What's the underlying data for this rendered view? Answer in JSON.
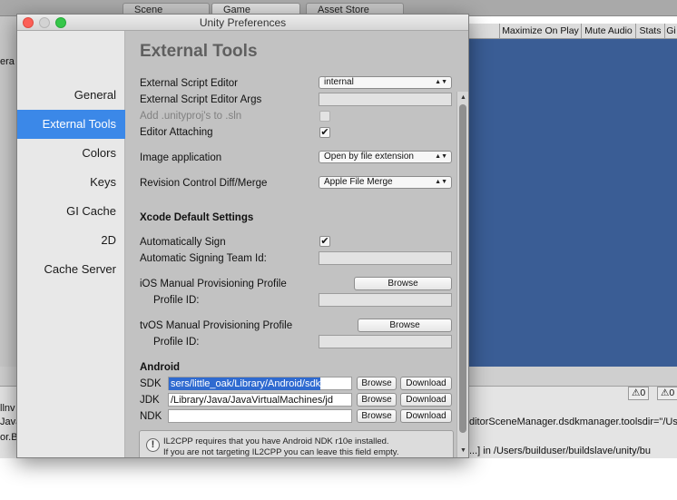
{
  "background": {
    "tabs": [
      "Scene",
      "Game",
      "Asset Store"
    ],
    "game_toolbar": [
      "Maximize On Play",
      "Mute Audio",
      "Stats",
      "Gi"
    ],
    "left_text": "era",
    "console_lines": [
      "llnv",
      "Java",
      "or.B",
      "ditorSceneManager.dsdkmanager.toolsdir=\"/Users/little_oak/Lib",
      "...] in /Users/builduser/buildslave/unity/bu"
    ],
    "console_counts": [
      "0",
      "0"
    ],
    "colors": {
      "game_view": "#3a5d95"
    }
  },
  "window": {
    "title": "Unity Preferences",
    "sidebar": {
      "items": [
        {
          "label": "General",
          "selected": false
        },
        {
          "label": "External Tools",
          "selected": true
        },
        {
          "label": "Colors",
          "selected": false
        },
        {
          "label": "Keys",
          "selected": false
        },
        {
          "label": "GI Cache",
          "selected": false
        },
        {
          "label": "2D",
          "selected": false
        },
        {
          "label": "Cache Server",
          "selected": false
        }
      ]
    },
    "content": {
      "heading": "External Tools",
      "external_script_editor": {
        "label": "External Script Editor",
        "value": "internal"
      },
      "external_script_editor_args": {
        "label": "External Script Editor Args",
        "value": ""
      },
      "add_unityproj": {
        "label": "Add .unityproj's to .sln",
        "checked": false
      },
      "editor_attaching": {
        "label": "Editor Attaching",
        "checked": true
      },
      "image_application": {
        "label": "Image application",
        "value": "Open by file extension"
      },
      "revision_control": {
        "label": "Revision Control Diff/Merge",
        "value": "Apple File Merge"
      },
      "xcode_header": "Xcode Default Settings",
      "automatically_sign": {
        "label": "Automatically Sign",
        "checked": true
      },
      "signing_team_id": {
        "label": "Automatic Signing Team Id:",
        "value": ""
      },
      "ios_profile": {
        "label": "iOS Manual Provisioning Profile",
        "browse": "Browse",
        "profile_id_label": "Profile ID:",
        "profile_id": ""
      },
      "tvos_profile": {
        "label": "tvOS Manual Provisioning Profile",
        "browse": "Browse",
        "profile_id_label": "Profile ID:",
        "profile_id": ""
      },
      "android_header": "Android",
      "sdk": {
        "label": "SDK",
        "value": "sers/little_oak/Library/Android/sdk",
        "browse": "Browse",
        "download": "Download"
      },
      "jdk": {
        "label": "JDK",
        "value": "/Library/Java/JavaVirtualMachines/jd",
        "browse": "Browse",
        "download": "Download"
      },
      "ndk": {
        "label": "NDK",
        "value": "",
        "browse": "Browse",
        "download": "Download"
      },
      "help_lines": [
        "IL2CPP requires that you have Android NDK r10e installed.",
        "If you are not targeting IL2CPP you can leave this field empty."
      ],
      "help_icon": "info-icon",
      "colors": {
        "selection": "#3b88e8"
      }
    }
  }
}
